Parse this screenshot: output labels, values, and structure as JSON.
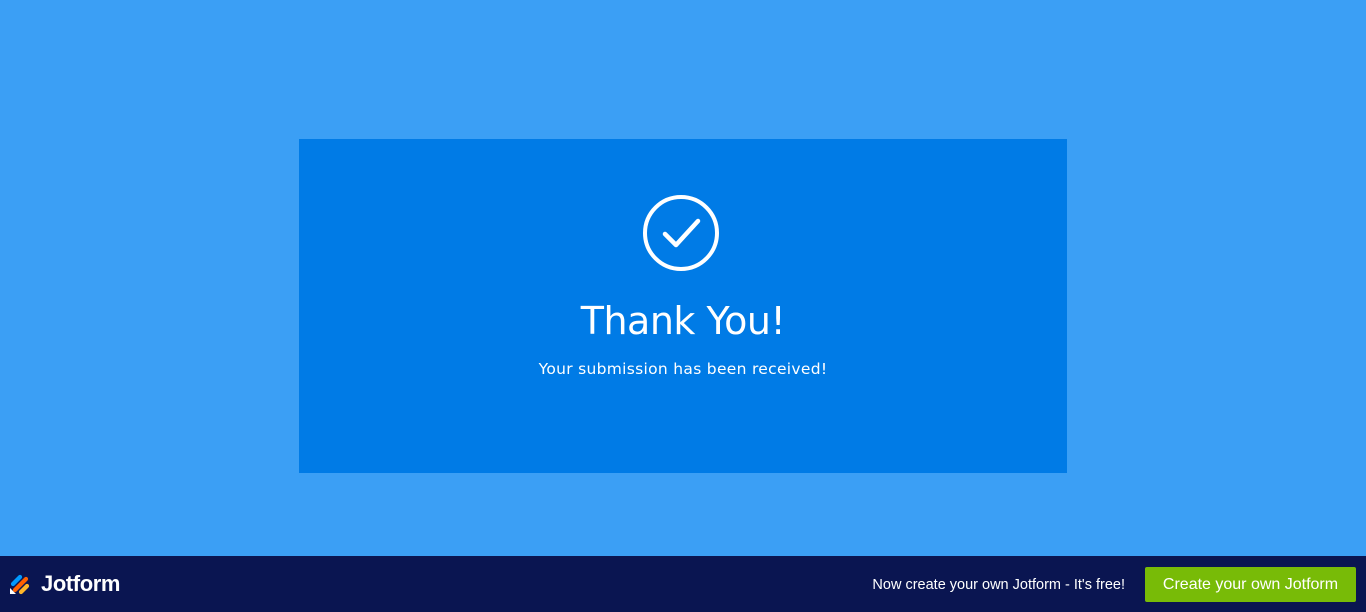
{
  "confirmation": {
    "title": "Thank You!",
    "message": "Your submission has been received!",
    "icon": "check-circle-icon"
  },
  "footer": {
    "brand_name": "Jotform",
    "promo_text": "Now create your own Jotform - It's free!",
    "cta_label": "Create your own Jotform"
  },
  "colors": {
    "page_background": "#3b9ff5",
    "card_background": "#007be6",
    "footer_background": "#0a1551",
    "cta_background": "#78bb07",
    "text": "#ffffff"
  }
}
